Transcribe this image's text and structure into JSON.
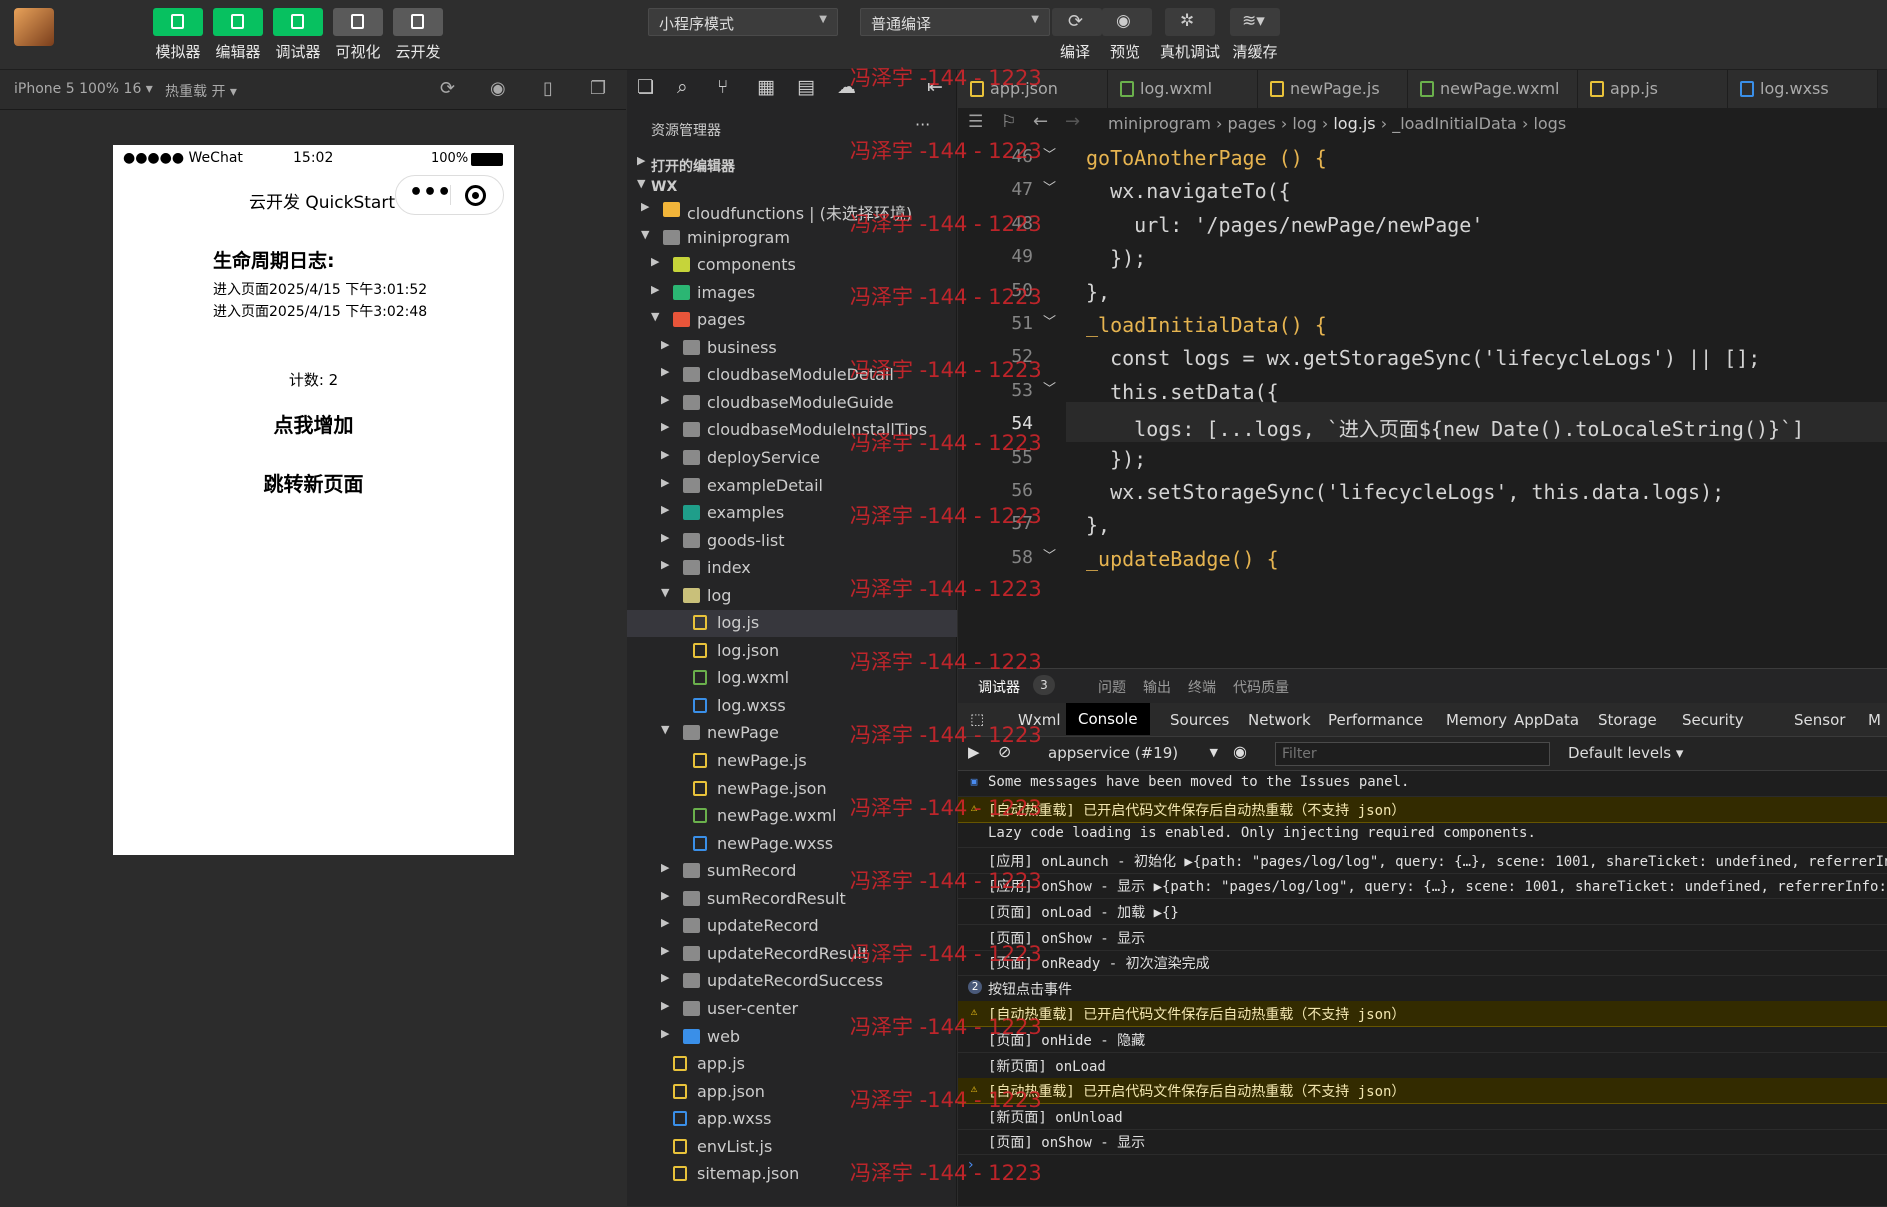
{
  "toolbar": {
    "buttons": [
      {
        "label": "模拟器",
        "icon": "phone-icon",
        "active": true
      },
      {
        "label": "编辑器",
        "icon": "code-icon",
        "active": true
      },
      {
        "label": "调试器",
        "icon": "debug-icon",
        "active": true
      },
      {
        "label": "可视化",
        "icon": "layout-icon",
        "active": false
      },
      {
        "label": "云开发",
        "icon": "cloud-icon",
        "active": false
      }
    ],
    "mode_select": "小程序模式",
    "compile_select": "普通编译",
    "actions": [
      "编译",
      "预览",
      "真机调试",
      "清缓存"
    ]
  },
  "simbar": {
    "device": "iPhone 5 100% 16",
    "hotreload": "热重载 开"
  },
  "phone": {
    "signal": "●●●●● WeChat",
    "time": "15:02",
    "battery": "100%",
    "nav_title": "云开发 QuickStart",
    "capsule_more": "•••",
    "log_title": "生命周期日志:",
    "logs": [
      "进入页面2025/4/15 下午3:01:52",
      "进入页面2025/4/15 下午3:02:48"
    ],
    "count": "计数: 2",
    "btn_add": "点我增加",
    "btn_jump": "跳转新页面"
  },
  "explorer": {
    "title": "资源管理器",
    "more": "···",
    "open_editors": "打开的编辑器",
    "root": "WX",
    "items": [
      {
        "label": "cloudfunctions | (未选择环境)",
        "depth": 1,
        "arrow": "▶",
        "color": "#f2b53a"
      },
      {
        "label": "miniprogram",
        "depth": 1,
        "arrow": "▼",
        "color": "#8a8a8a"
      },
      {
        "label": "components",
        "depth": 2,
        "arrow": "▶",
        "color": "#c6d43a"
      },
      {
        "label": "images",
        "depth": 2,
        "arrow": "▶",
        "color": "#2bb673"
      },
      {
        "label": "pages",
        "depth": 2,
        "arrow": "▼",
        "color": "#e8553a"
      },
      {
        "label": "business",
        "depth": 3,
        "arrow": "▶",
        "color": "#8a8a8a"
      },
      {
        "label": "cloudbaseModuleDetail",
        "depth": 3,
        "arrow": "▶",
        "color": "#8a8a8a"
      },
      {
        "label": "cloudbaseModuleGuide",
        "depth": 3,
        "arrow": "▶",
        "color": "#8a8a8a"
      },
      {
        "label": "cloudbaseModuleInstallTips",
        "depth": 3,
        "arrow": "▶",
        "color": "#8a8a8a"
      },
      {
        "label": "deployService",
        "depth": 3,
        "arrow": "▶",
        "color": "#8a8a8a"
      },
      {
        "label": "exampleDetail",
        "depth": 3,
        "arrow": "▶",
        "color": "#8a8a8a"
      },
      {
        "label": "examples",
        "depth": 3,
        "arrow": "▶",
        "color": "#1f9e8a"
      },
      {
        "label": "goods-list",
        "depth": 3,
        "arrow": "▶",
        "color": "#8a8a8a"
      },
      {
        "label": "index",
        "depth": 3,
        "arrow": "▶",
        "color": "#8a8a8a"
      },
      {
        "label": "log",
        "depth": 3,
        "arrow": "▼",
        "color": "#c9c07a"
      },
      {
        "label": "log.js",
        "depth": 4,
        "arrow": "",
        "color": "#e8c23a",
        "selected": true
      },
      {
        "label": "log.json",
        "depth": 4,
        "arrow": "",
        "color": "#e8c23a"
      },
      {
        "label": "log.wxml",
        "depth": 4,
        "arrow": "",
        "color": "#6ab04c"
      },
      {
        "label": "log.wxss",
        "depth": 4,
        "arrow": "",
        "color": "#3a8fe8"
      },
      {
        "label": "newPage",
        "depth": 3,
        "arrow": "▼",
        "color": "#8a8a8a"
      },
      {
        "label": "newPage.js",
        "depth": 4,
        "arrow": "",
        "color": "#e8c23a"
      },
      {
        "label": "newPage.json",
        "depth": 4,
        "arrow": "",
        "color": "#e8c23a"
      },
      {
        "label": "newPage.wxml",
        "depth": 4,
        "arrow": "",
        "color": "#6ab04c"
      },
      {
        "label": "newPage.wxss",
        "depth": 4,
        "arrow": "",
        "color": "#3a8fe8"
      },
      {
        "label": "sumRecord",
        "depth": 3,
        "arrow": "▶",
        "color": "#8a8a8a"
      },
      {
        "label": "sumRecordResult",
        "depth": 3,
        "arrow": "▶",
        "color": "#8a8a8a"
      },
      {
        "label": "updateRecord",
        "depth": 3,
        "arrow": "▶",
        "color": "#8a8a8a"
      },
      {
        "label": "updateRecordResult",
        "depth": 3,
        "arrow": "▶",
        "color": "#8a8a8a"
      },
      {
        "label": "updateRecordSuccess",
        "depth": 3,
        "arrow": "▶",
        "color": "#8a8a8a"
      },
      {
        "label": "user-center",
        "depth": 3,
        "arrow": "▶",
        "color": "#8a8a8a"
      },
      {
        "label": "web",
        "depth": 3,
        "arrow": "▶",
        "color": "#3a8fe8"
      },
      {
        "label": "app.js",
        "depth": 2,
        "arrow": "",
        "color": "#e8c23a"
      },
      {
        "label": "app.json",
        "depth": 2,
        "arrow": "",
        "color": "#e8c23a"
      },
      {
        "label": "app.wxss",
        "depth": 2,
        "arrow": "",
        "color": "#3a8fe8"
      },
      {
        "label": "envList.js",
        "depth": 2,
        "arrow": "",
        "color": "#e8c23a"
      },
      {
        "label": "sitemap.json",
        "depth": 2,
        "arrow": "",
        "color": "#e8c23a"
      }
    ]
  },
  "editor": {
    "tabs": [
      {
        "label": "app.json",
        "color": "#e8c23a"
      },
      {
        "label": "log.wxml",
        "color": "#6ab04c"
      },
      {
        "label": "newPage.js",
        "color": "#e8c23a"
      },
      {
        "label": "newPage.wxml",
        "color": "#6ab04c"
      },
      {
        "label": "app.js",
        "color": "#e8c23a"
      },
      {
        "label": "log.wxss",
        "color": "#3a8fe8"
      }
    ],
    "breadcrumb": [
      "miniprogram",
      "pages",
      "log",
      "log.js",
      "_loadInitialData",
      "logs"
    ],
    "lines": [
      {
        "n": "46",
        "t": "goToAnotherPage () {"
      },
      {
        "n": "47",
        "t": "  wx.navigateTo({"
      },
      {
        "n": "48",
        "t": "    url: '/pages/newPage/newPage'"
      },
      {
        "n": "49",
        "t": "  });"
      },
      {
        "n": "50",
        "t": "},"
      },
      {
        "n": "51",
        "t": "_loadInitialData() {"
      },
      {
        "n": "52",
        "t": "  const logs = wx.getStorageSync('lifecycleLogs') || [];"
      },
      {
        "n": "53",
        "t": "  this.setData({"
      },
      {
        "n": "54",
        "t": "    logs: [...logs, `进入页面${new Date().toLocaleString()}`]"
      },
      {
        "n": "55",
        "t": "  });"
      },
      {
        "n": "56",
        "t": "  wx.setStorageSync('lifecycleLogs', this.data.logs);"
      },
      {
        "n": "57",
        "t": "},"
      },
      {
        "n": "58",
        "t": "_updateBadge() {"
      }
    ]
  },
  "debugger": {
    "top_tabs": [
      "调试器",
      "问题",
      "输出",
      "终端",
      "代码质量"
    ],
    "badge": "3",
    "tabs": [
      "Wxml",
      "Console",
      "Sources",
      "Network",
      "Performance",
      "Memory",
      "AppData",
      "Storage",
      "Security",
      "Sensor",
      "M"
    ],
    "context": "appservice (#19)",
    "filter_placeholder": "Filter",
    "levels": "Default levels",
    "console": [
      {
        "type": "info",
        "text": "Some messages have been moved to the Issues panel."
      },
      {
        "type": "warn",
        "text": "[自动热重载] 已开启代码文件保存后自动热重载（不支持 json）"
      },
      {
        "type": "log",
        "text": "Lazy code loading is enabled. Only injecting required components."
      },
      {
        "type": "log",
        "text": "[应用] onLaunch - 初始化 ▶{path: \"pages/log/log\", query: {…}, scene: 1001, shareTicket: undefined, referrerInfo"
      },
      {
        "type": "log",
        "text": "[应用] onShow - 显示 ▶{path: \"pages/log/log\", query: {…}, scene: 1001, shareTicket: undefined, referrerInfo: {"
      },
      {
        "type": "log",
        "text": "[页面] onLoad - 加载 ▶{}"
      },
      {
        "type": "log",
        "text": "[页面] onShow - 显示"
      },
      {
        "type": "log",
        "text": "[页面] onReady - 初次渲染完成"
      },
      {
        "type": "count",
        "text": "按钮点击事件",
        "count": "2"
      },
      {
        "type": "warn",
        "text": "[自动热重载] 已开启代码文件保存后自动热重载（不支持 json）"
      },
      {
        "type": "log",
        "text": "[页面] onHide - 隐藏"
      },
      {
        "type": "log",
        "text": "[新页面] onLoad"
      },
      {
        "type": "warn",
        "text": "[自动热重载] 已开启代码文件保存后自动热重载（不支持 json）"
      },
      {
        "type": "log",
        "text": "[新页面] onUnload"
      },
      {
        "type": "log",
        "text": "[页面] onShow - 显示"
      }
    ]
  },
  "watermark": "冯泽宇 -144 - 1223",
  "colors": {
    "accent": "#07c160",
    "watermark": "#d9262c",
    "warn_bg": "#332b00"
  }
}
